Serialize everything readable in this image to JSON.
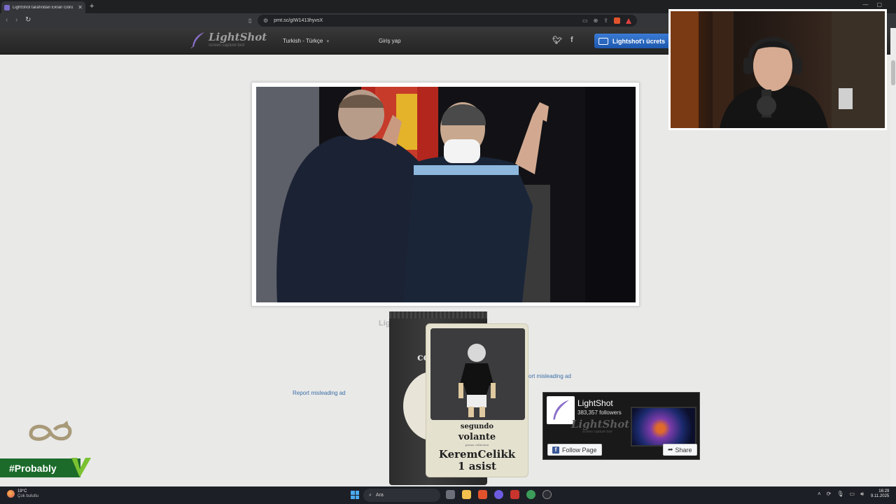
{
  "browser": {
    "tab_title": "LightShot tarafından Ekran Görü",
    "url": "prnt.sc/gIW1413hyvsX"
  },
  "lightshot": {
    "logo_title": "LightShot",
    "logo_subtitle": "screen capture tool",
    "language": "Turkish - Türkçe",
    "login": "Giriş yap",
    "download_button": "Lightshot'ı ücrets",
    "faded_label": "Lig",
    "report_ad_left": "Report misleading ad",
    "report_ad_right": "ort misleading ad"
  },
  "ad_card": {
    "line1": "segundo",
    "line2": "volante",
    "line3": "pizzas collection",
    "player": "KeremCelikk",
    "stat": "1 asist",
    "pack_brand": "co"
  },
  "facebook_widget": {
    "page_name": "LightShot",
    "followers": "383,357 followers",
    "wordmark": "LightShot",
    "wordmark_sub": "screen capture tool",
    "follow_label": "Follow Page",
    "share_label": "Share"
  },
  "overlay": {
    "hashtag": "#Probably"
  },
  "taskbar": {
    "temperature": "19°C",
    "weather": "Çok bulutlu",
    "search": "Ara",
    "time": "16:29",
    "date": "9.11.2025"
  },
  "colors": {
    "page_bg": "#e9e9e8",
    "header_bg": "#2e2e2e",
    "download_button": "#2c6bc4",
    "link": "#3a6ea5",
    "hashtag_banner": "#1c6b2b",
    "hashtag_accent": "#7ac231"
  }
}
